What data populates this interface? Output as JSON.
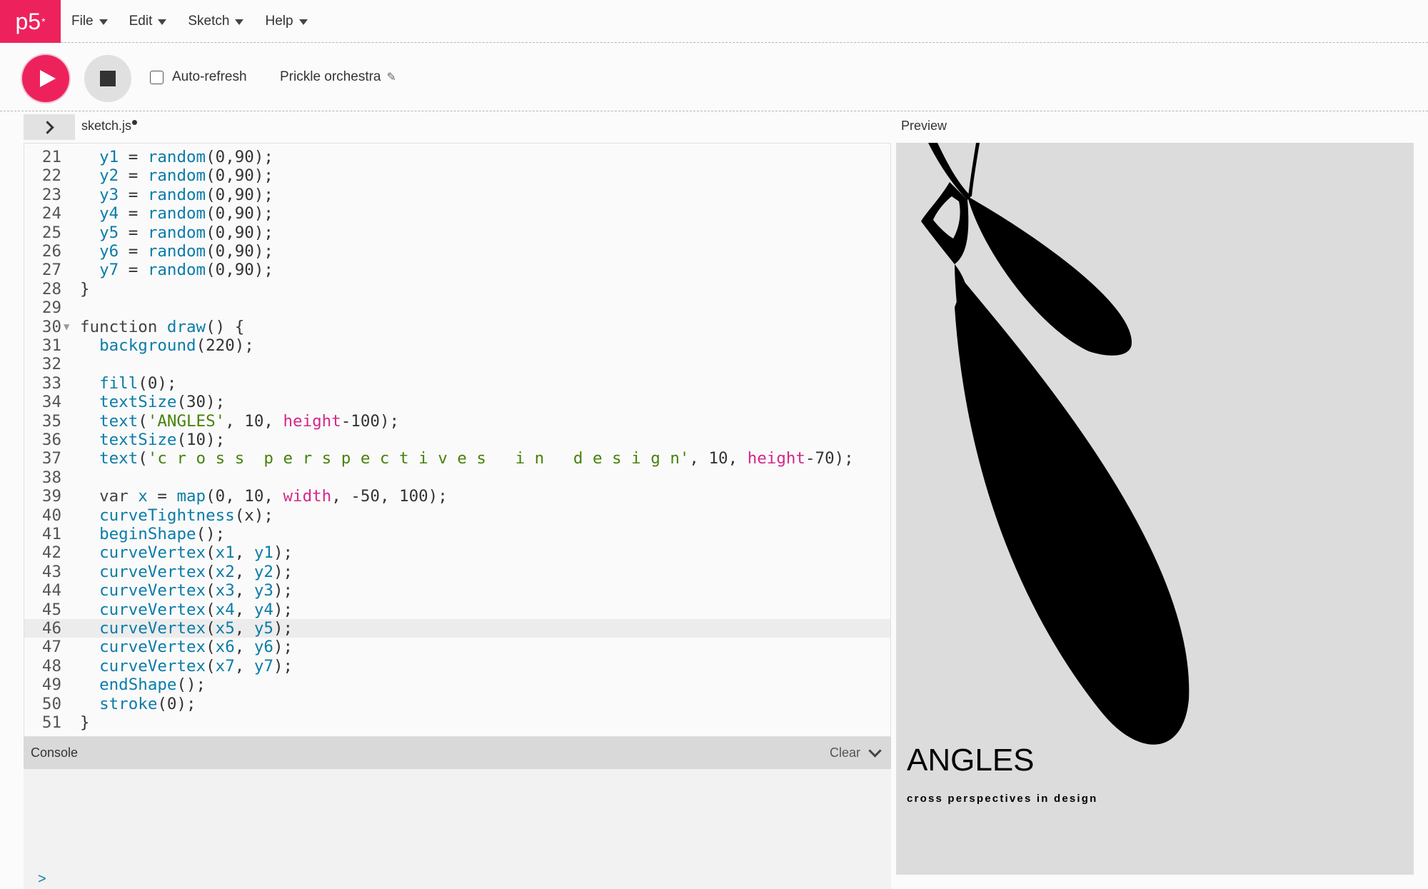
{
  "app": {
    "logo": "p5",
    "logo_mark": "*"
  },
  "menu": [
    {
      "label": "File"
    },
    {
      "label": "Edit"
    },
    {
      "label": "Sketch"
    },
    {
      "label": "Help"
    }
  ],
  "toolbar": {
    "auto_refresh_label": "Auto-refresh",
    "auto_refresh_checked": false,
    "sketch_name": "Prickle orchestra"
  },
  "editor": {
    "file_tab": "sketch.js",
    "active_line": 46,
    "lines": [
      {
        "n": "21",
        "tokens": [
          [
            "p",
            "  "
          ],
          [
            "fn",
            "y1"
          ],
          [
            "p",
            " = "
          ],
          [
            "fn",
            "random"
          ],
          [
            "p",
            "(0,90);"
          ]
        ]
      },
      {
        "n": "22",
        "tokens": [
          [
            "p",
            "  "
          ],
          [
            "fn",
            "y2"
          ],
          [
            "p",
            " = "
          ],
          [
            "fn",
            "random"
          ],
          [
            "p",
            "(0,90);"
          ]
        ]
      },
      {
        "n": "23",
        "tokens": [
          [
            "p",
            "  "
          ],
          [
            "fn",
            "y3"
          ],
          [
            "p",
            " = "
          ],
          [
            "fn",
            "random"
          ],
          [
            "p",
            "(0,90);"
          ]
        ]
      },
      {
        "n": "24",
        "tokens": [
          [
            "p",
            "  "
          ],
          [
            "fn",
            "y4"
          ],
          [
            "p",
            " = "
          ],
          [
            "fn",
            "random"
          ],
          [
            "p",
            "(0,90);"
          ]
        ]
      },
      {
        "n": "25",
        "tokens": [
          [
            "p",
            "  "
          ],
          [
            "fn",
            "y5"
          ],
          [
            "p",
            " = "
          ],
          [
            "fn",
            "random"
          ],
          [
            "p",
            "(0,90);"
          ]
        ]
      },
      {
        "n": "26",
        "tokens": [
          [
            "p",
            "  "
          ],
          [
            "fn",
            "y6"
          ],
          [
            "p",
            " = "
          ],
          [
            "fn",
            "random"
          ],
          [
            "p",
            "(0,90);"
          ]
        ]
      },
      {
        "n": "27",
        "tokens": [
          [
            "p",
            "  "
          ],
          [
            "fn",
            "y7"
          ],
          [
            "p",
            " = "
          ],
          [
            "fn",
            "random"
          ],
          [
            "p",
            "(0,90);"
          ]
        ]
      },
      {
        "n": "28",
        "tokens": [
          [
            "p",
            "}"
          ]
        ]
      },
      {
        "n": "29",
        "tokens": []
      },
      {
        "n": "30",
        "fold": true,
        "tokens": [
          [
            "kw",
            "function "
          ],
          [
            "fn",
            "draw"
          ],
          [
            "p",
            "() {"
          ]
        ]
      },
      {
        "n": "31",
        "tokens": [
          [
            "p",
            "  "
          ],
          [
            "fn",
            "background"
          ],
          [
            "p",
            "(220);"
          ]
        ]
      },
      {
        "n": "32",
        "tokens": []
      },
      {
        "n": "33",
        "tokens": [
          [
            "p",
            "  "
          ],
          [
            "fn",
            "fill"
          ],
          [
            "p",
            "(0);"
          ]
        ]
      },
      {
        "n": "34",
        "tokens": [
          [
            "p",
            "  "
          ],
          [
            "fn",
            "textSize"
          ],
          [
            "p",
            "(30);"
          ]
        ]
      },
      {
        "n": "35",
        "tokens": [
          [
            "p",
            "  "
          ],
          [
            "fn",
            "text"
          ],
          [
            "p",
            "("
          ],
          [
            "str",
            "'ANGLES'"
          ],
          [
            "p",
            ", 10, "
          ],
          [
            "const",
            "height"
          ],
          [
            "p",
            "-100);"
          ]
        ]
      },
      {
        "n": "36",
        "tokens": [
          [
            "p",
            "  "
          ],
          [
            "fn",
            "textSize"
          ],
          [
            "p",
            "(10);"
          ]
        ]
      },
      {
        "n": "37",
        "tokens": [
          [
            "p",
            "  "
          ],
          [
            "fn",
            "text"
          ],
          [
            "p",
            "("
          ],
          [
            "str",
            "'c r o s s  p e r s p e c t i v e s   i n   d e s i g n'"
          ],
          [
            "p",
            ", 10, "
          ],
          [
            "const",
            "height"
          ],
          [
            "p",
            "-70);"
          ]
        ]
      },
      {
        "n": "38",
        "tokens": []
      },
      {
        "n": "39",
        "tokens": [
          [
            "p",
            "  "
          ],
          [
            "kw",
            "var "
          ],
          [
            "fn",
            "x"
          ],
          [
            "p",
            " = "
          ],
          [
            "fn",
            "map"
          ],
          [
            "p",
            "(0, 10, "
          ],
          [
            "const",
            "width"
          ],
          [
            "p",
            ", -50, 100);"
          ]
        ]
      },
      {
        "n": "40",
        "tokens": [
          [
            "p",
            "  "
          ],
          [
            "fn",
            "curveTightness"
          ],
          [
            "p",
            "(x);"
          ]
        ]
      },
      {
        "n": "41",
        "tokens": [
          [
            "p",
            "  "
          ],
          [
            "fn",
            "beginShape"
          ],
          [
            "p",
            "();"
          ]
        ]
      },
      {
        "n": "42",
        "tokens": [
          [
            "p",
            "  "
          ],
          [
            "fn",
            "curveVertex"
          ],
          [
            "p",
            "("
          ],
          [
            "fn",
            "x1"
          ],
          [
            "p",
            ", "
          ],
          [
            "fn",
            "y1"
          ],
          [
            "p",
            ");"
          ]
        ]
      },
      {
        "n": "43",
        "tokens": [
          [
            "p",
            "  "
          ],
          [
            "fn",
            "curveVertex"
          ],
          [
            "p",
            "("
          ],
          [
            "fn",
            "x2"
          ],
          [
            "p",
            ", "
          ],
          [
            "fn",
            "y2"
          ],
          [
            "p",
            ");"
          ]
        ]
      },
      {
        "n": "44",
        "tokens": [
          [
            "p",
            "  "
          ],
          [
            "fn",
            "curveVertex"
          ],
          [
            "p",
            "("
          ],
          [
            "fn",
            "x3"
          ],
          [
            "p",
            ", "
          ],
          [
            "fn",
            "y3"
          ],
          [
            "p",
            ");"
          ]
        ]
      },
      {
        "n": "45",
        "tokens": [
          [
            "p",
            "  "
          ],
          [
            "fn",
            "curveVertex"
          ],
          [
            "p",
            "("
          ],
          [
            "fn",
            "x4"
          ],
          [
            "p",
            ", "
          ],
          [
            "fn",
            "y4"
          ],
          [
            "p",
            ");"
          ]
        ]
      },
      {
        "n": "46",
        "tokens": [
          [
            "p",
            "  "
          ],
          [
            "fn",
            "curveVertex"
          ],
          [
            "p",
            "("
          ],
          [
            "fn",
            "x5"
          ],
          [
            "p",
            ", "
          ],
          [
            "fn",
            "y5"
          ],
          [
            "p",
            ");"
          ]
        ]
      },
      {
        "n": "47",
        "tokens": [
          [
            "p",
            "  "
          ],
          [
            "fn",
            "curveVertex"
          ],
          [
            "p",
            "("
          ],
          [
            "fn",
            "x6"
          ],
          [
            "p",
            ", "
          ],
          [
            "fn",
            "y6"
          ],
          [
            "p",
            ");"
          ]
        ]
      },
      {
        "n": "48",
        "tokens": [
          [
            "p",
            "  "
          ],
          [
            "fn",
            "curveVertex"
          ],
          [
            "p",
            "("
          ],
          [
            "fn",
            "x7"
          ],
          [
            "p",
            ", "
          ],
          [
            "fn",
            "y7"
          ],
          [
            "p",
            ");"
          ]
        ]
      },
      {
        "n": "49",
        "tokens": [
          [
            "p",
            "  "
          ],
          [
            "fn",
            "endShape"
          ],
          [
            "p",
            "();"
          ]
        ]
      },
      {
        "n": "50",
        "tokens": [
          [
            "p",
            "  "
          ],
          [
            "fn",
            "stroke"
          ],
          [
            "p",
            "(0);"
          ]
        ]
      },
      {
        "n": "51",
        "tokens": [
          [
            "p",
            "}"
          ]
        ]
      }
    ]
  },
  "console": {
    "title": "Console",
    "clear_label": "Clear",
    "prompt": ">"
  },
  "preview": {
    "label": "Preview",
    "poster_title": "ANGLES",
    "poster_subtitle": "cross perspectives in design"
  },
  "colors": {
    "brand": "#ed225d",
    "function": "#0b7ca9",
    "string": "#47820a",
    "constant": "#d52889"
  }
}
